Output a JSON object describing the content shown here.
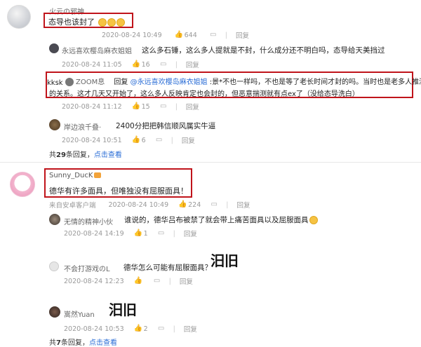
{
  "thread1": {
    "user": "火云の邪神",
    "comment": "态导也该封了",
    "time": "2020-08-24 10:49",
    "likes": "644",
    "replies_count": "",
    "reply_label": "回复",
    "replies": [
      {
        "user": "永远喜欢樱岛麻衣姐姐",
        "text": "这么多石锤，这么多人提就是不封，什么成分还不明白吗，态导给天美挡过",
        "time": "2020-08-24 11:05",
        "likes": "16"
      },
      {
        "user": "ZOOM息",
        "reply_prefix": "回复",
        "reply_to": "@永远喜欢樱岛麻衣姐姐",
        "text_line1": ":景*不也一样吗，不也是等了老长时间才封的吗。当时也是老多人推测景*",
        "text_line2": "的关系。这才几天又开始了，这么多人反映肯定也会封的，但恶意揣测就有点ex了（没给态导洗白）",
        "time": "2020-08-24 11:12",
        "likes": "15"
      },
      {
        "user": "岸边浪千叠·",
        "text": "2400分把把韩信顺风属实牛逼",
        "time": "2020-08-24 10:51",
        "likes": "6"
      }
    ],
    "more_prefix": "共",
    "more_count": "29",
    "more_suffix": "条回复，",
    "more_link": "点击查看"
  },
  "thread2": {
    "user": "Sunny_DucK",
    "comment": "德华有许多面具，但唯独没有屈服面具！",
    "source": "来自安卓客户端",
    "time": "2020-08-24 10:49",
    "likes": "224",
    "reply_label": "回复",
    "replies": [
      {
        "user": "无情的精神小伙",
        "text": "谁说的，德华吕布被禁了就会带上痛苦面具以及屈服面具",
        "time": "2020-08-24 14:19",
        "likes": "1"
      },
      {
        "user": "不会打游戏のL",
        "text": "德华怎么可能有屈服面具？",
        "handwritten": "汨旧",
        "time": "2020-08-24 12:23",
        "likes": ""
      },
      {
        "user": "嵩然Yuan",
        "handwritten": "汨旧",
        "time": "2020-08-24 10:53",
        "likes": "2"
      }
    ],
    "more_prefix": "共",
    "more_count": "7",
    "more_suffix": "条回复，",
    "more_link": "点击查看"
  },
  "side_label": "kksk",
  "colors": {
    "highlight_border": "#c0141b",
    "link": "#2a6dd6"
  }
}
